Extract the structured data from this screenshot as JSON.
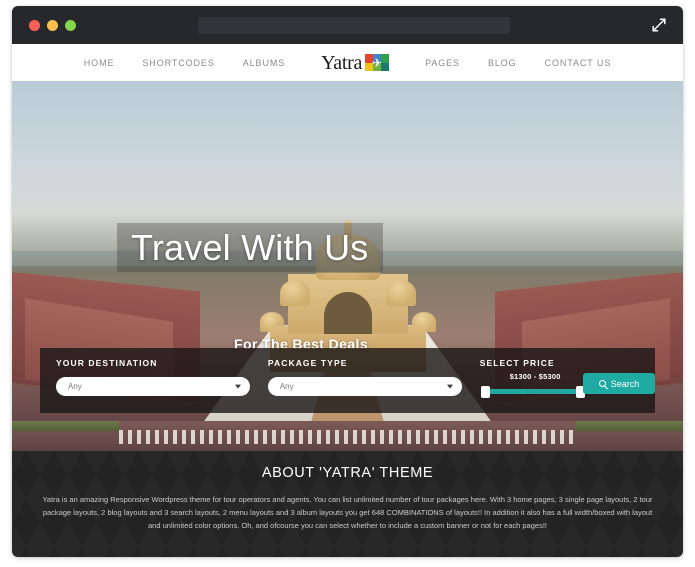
{
  "browser": {
    "traffic_lights": [
      "close",
      "minimize",
      "maximize"
    ],
    "url_value": "",
    "expand_icon": "expand-arrows-icon"
  },
  "nav": {
    "left_items": [
      {
        "label": "HOME"
      },
      {
        "label": "SHORTCODES"
      },
      {
        "label": "ALBUMS"
      }
    ],
    "right_items": [
      {
        "label": "PAGES"
      },
      {
        "label": "BLOG"
      },
      {
        "label": "CONTACT US"
      }
    ],
    "logo": {
      "text": "Yatra",
      "mark_icon": "airplane-icon",
      "mark_colors": [
        "#e8412f",
        "#4285c8",
        "#2f9e4f",
        "#f0c419",
        "#6fb344",
        "#1a7a6e"
      ]
    }
  },
  "hero": {
    "title": "Travel With Us",
    "subtitle": "For The Best Deals"
  },
  "search_panel": {
    "destination": {
      "label": "YOUR DESTINATION",
      "value": "Any",
      "chevron_icon": "chevron-down-icon"
    },
    "package": {
      "label": "PACKAGE TYPE",
      "value": "Any",
      "chevron_icon": "chevron-down-icon"
    },
    "price": {
      "label": "SELECT PRICE",
      "range_text": "$1300 - $5300",
      "min": "$1300",
      "max": "$5300",
      "track_color": "#1faaa4"
    },
    "search_button": {
      "label": "Search",
      "icon": "magnifier-icon",
      "color": "#1faaa4"
    }
  },
  "about": {
    "title": "ABOUT 'YATRA' THEME",
    "body": "Yatra is an amazing Responsive Wordpress theme for tour operators and agents. You can list unlimited number of tour packages here. With 3 home pages, 3 single page layouts, 2 tour package layouts, 2 blog layouts and 3 search layouts, 2 menu layouts and 3 album layouts you get 648 COMBINATIONS of layouts!! In addition it also has a full width/boxed with layout and unlimited color options. Oh, and ofcourse you can select whether to include a custom banner or not for each pages!!"
  }
}
